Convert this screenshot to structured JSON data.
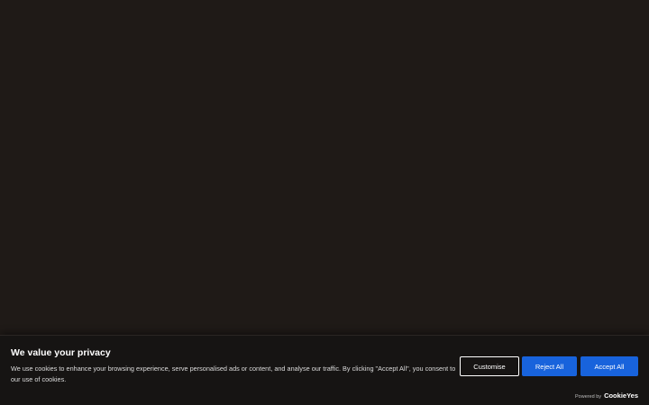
{
  "cookie_banner": {
    "title": "We value your privacy",
    "description": "We use cookies to enhance your browsing experience, serve personalised ads or content, and analyse our traffic. By clicking \"Accept All\", you consent to our use of cookies.",
    "buttons": {
      "customise": "Customise",
      "reject_all": "Reject All",
      "accept_all": "Accept All"
    },
    "powered_by": {
      "label": "Powered by",
      "brand": "CookieYes"
    }
  },
  "colors": {
    "page_background": "#1f1a17",
    "banner_background": "#161413",
    "accent": "#1863dc"
  }
}
